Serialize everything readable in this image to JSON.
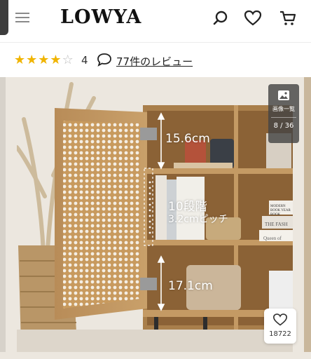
{
  "header": {
    "logo": "LOWYA",
    "icons": [
      "search-icon",
      "heart-icon",
      "cart-icon"
    ]
  },
  "rating": {
    "stars": 4,
    "max_stars": 5,
    "score": "4",
    "review_link": "77件のレビュー",
    "icon": "speech-bubble-icon"
  },
  "gallery": {
    "view_all_label": "画像一覧",
    "counter": "8 / 36",
    "dimensions": {
      "top_height": "15.6cm",
      "steps": "10段階",
      "pitch": "3.2cmピッチ",
      "bottom_height": "17.1cm"
    },
    "book_texts": {
      "book1": "MODERN BOOK YEAR BOOK",
      "book2": "THE FASH",
      "book3": "Queen of"
    }
  },
  "favorite": {
    "count": "18722",
    "icon": "heart-icon"
  },
  "colors": {
    "star": "#f0b400",
    "text": "#222222"
  }
}
